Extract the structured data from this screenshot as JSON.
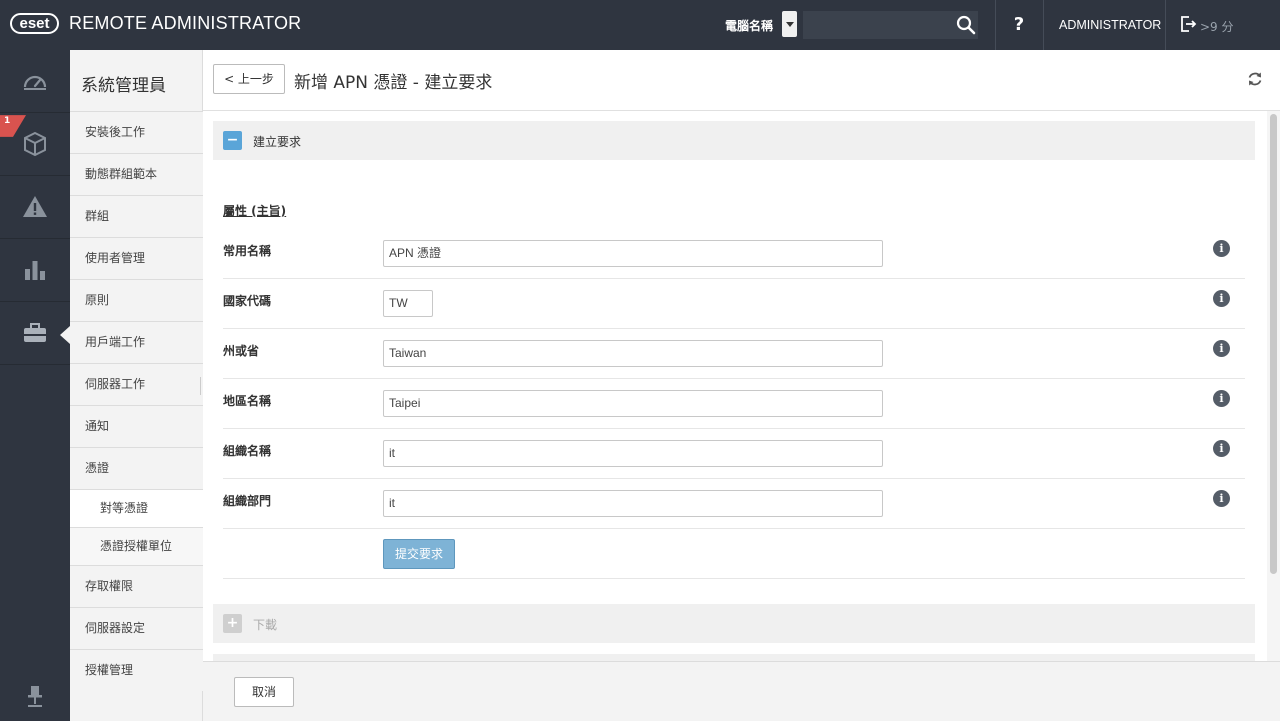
{
  "topbar": {
    "logo": "eset",
    "app_title": "REMOTE ADMINISTRATOR",
    "search_label": "電腦名稱",
    "search_value": "",
    "help": "?",
    "user": "ADMINISTRATOR",
    "session_time": ">9 分"
  },
  "rail": {
    "items": [
      "dashboard-icon",
      "computers-icon",
      "threats-icon",
      "reports-icon",
      "admin-icon"
    ],
    "badge": "1"
  },
  "subnav": {
    "title": "系統管理員",
    "items": [
      {
        "label": "安裝後工作"
      },
      {
        "label": "動態群組範本"
      },
      {
        "label": "群組"
      },
      {
        "label": "使用者管理"
      },
      {
        "label": "原則"
      },
      {
        "label": "用戶端工作"
      },
      {
        "label": "伺服器工作"
      },
      {
        "label": "通知"
      },
      {
        "label": "憑證"
      },
      {
        "label": "對等憑證"
      },
      {
        "label": "憑證授權單位"
      },
      {
        "label": "存取權限"
      },
      {
        "label": "伺服器設定"
      },
      {
        "label": "授權管理"
      }
    ]
  },
  "header": {
    "back_label": "< 上一步",
    "title": "新增 APN 憑證 - 建立要求"
  },
  "section_create": {
    "toggle": "−",
    "title": "建立要求"
  },
  "attributes": {
    "title": "屬性 (主旨)",
    "rows": [
      {
        "label": "常用名稱",
        "value": "APN 憑證"
      },
      {
        "label": "國家代碼",
        "value": "TW"
      },
      {
        "label": "州或省",
        "value": "Taiwan"
      },
      {
        "label": "地區名稱",
        "value": "Taipei"
      },
      {
        "label": "組織名稱",
        "value": "it"
      },
      {
        "label": "組織部門",
        "value": "it"
      }
    ],
    "info": "i",
    "submit_label": "提交要求"
  },
  "section_download": {
    "toggle": "+",
    "title": "下載"
  },
  "footer": {
    "cancel_label": "取消"
  }
}
